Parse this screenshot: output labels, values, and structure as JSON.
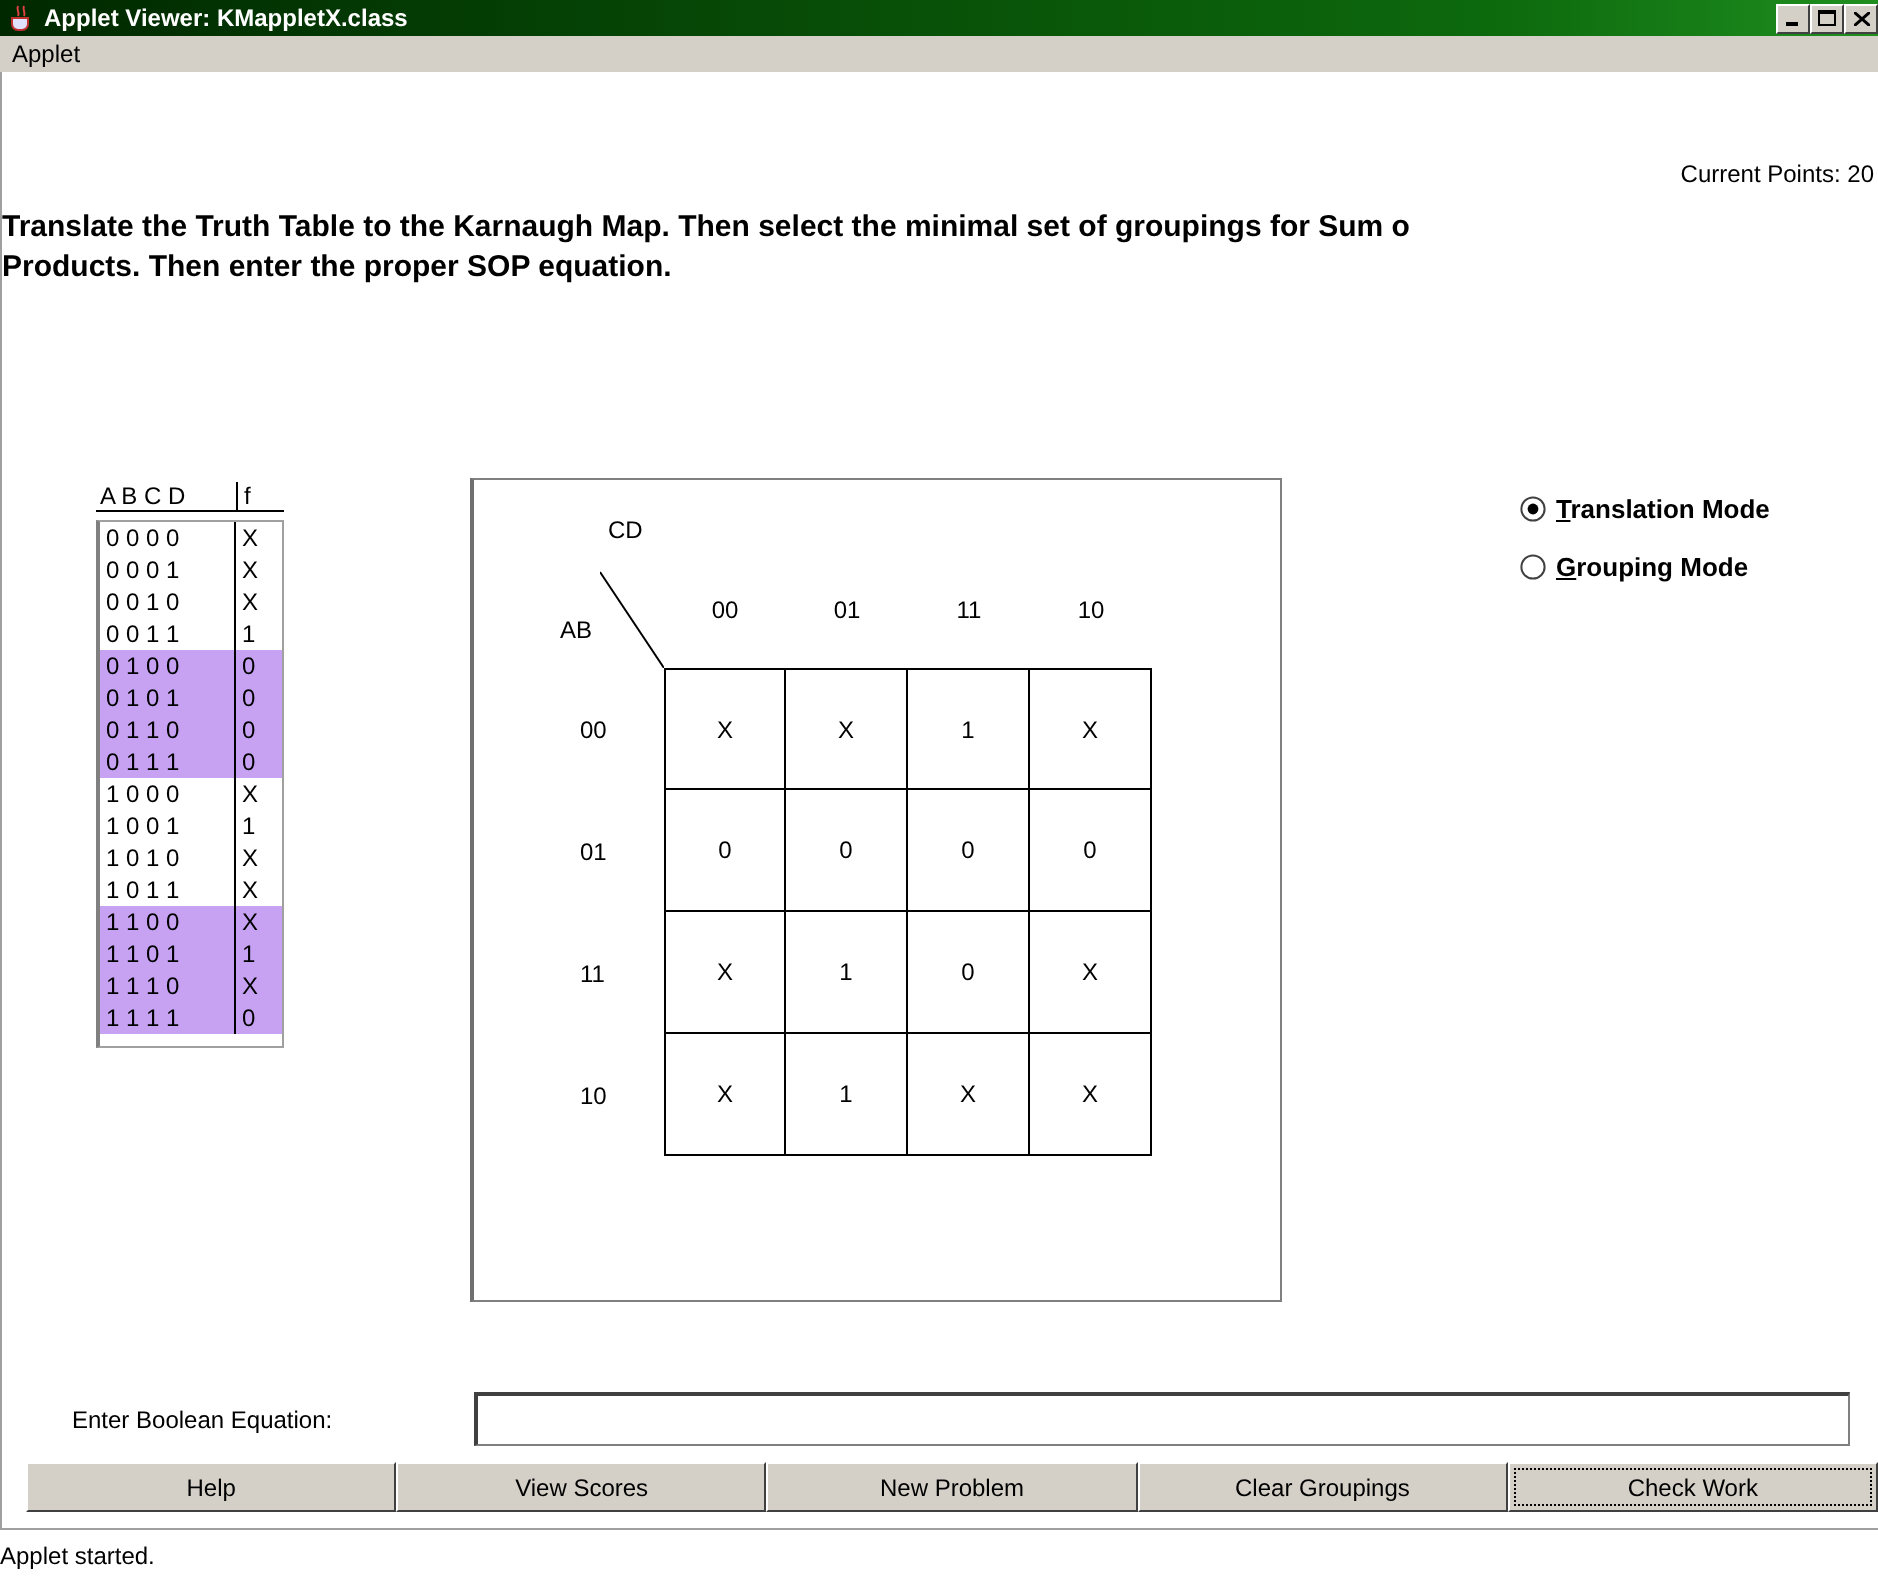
{
  "window": {
    "title": "Applet Viewer: KMappletX.class"
  },
  "menu": [
    "Applet"
  ],
  "points": "Current Points: 20",
  "instructions": [
    "Translate the Truth Table to the Karnaugh Map. Then select the minimal set of groupings for Sum o",
    "Products. Then enter the proper SOP equation."
  ],
  "truth_table": {
    "input_header": "A B C D",
    "output_header": "f",
    "rows": [
      {
        "inputs": "0 0 0 0",
        "f": "X",
        "highlighted": false
      },
      {
        "inputs": "0 0 0 1",
        "f": "X",
        "highlighted": false
      },
      {
        "inputs": "0 0 1 0",
        "f": "X",
        "highlighted": false
      },
      {
        "inputs": "0 0 1 1",
        "f": "1",
        "highlighted": false
      },
      {
        "inputs": "0 1 0 0",
        "f": "0",
        "highlighted": true
      },
      {
        "inputs": "0 1 0 1",
        "f": "0",
        "highlighted": true
      },
      {
        "inputs": "0 1 1 0",
        "f": "0",
        "highlighted": true
      },
      {
        "inputs": "0 1 1 1",
        "f": "0",
        "highlighted": true
      },
      {
        "inputs": "1 0 0 0",
        "f": "X",
        "highlighted": false
      },
      {
        "inputs": "1 0 0 1",
        "f": "1",
        "highlighted": false
      },
      {
        "inputs": "1 0 1 0",
        "f": "X",
        "highlighted": false
      },
      {
        "inputs": "1 0 1 1",
        "f": "X",
        "highlighted": false
      },
      {
        "inputs": "1 1 0 0",
        "f": "X",
        "highlighted": true
      },
      {
        "inputs": "1 1 0 1",
        "f": "1",
        "highlighted": true
      },
      {
        "inputs": "1 1 1 0",
        "f": "X",
        "highlighted": true
      },
      {
        "inputs": "1 1 1 1",
        "f": "0",
        "highlighted": true
      }
    ]
  },
  "kmap": {
    "column_variables": "CD",
    "row_variables": "AB",
    "columns": [
      "00",
      "01",
      "11",
      "10"
    ],
    "rows": [
      {
        "label": "00",
        "cells": [
          "X",
          "X",
          "1",
          "X"
        ]
      },
      {
        "label": "01",
        "cells": [
          "0",
          "0",
          "0",
          "0"
        ]
      },
      {
        "label": "11",
        "cells": [
          "X",
          "1",
          "0",
          "X"
        ]
      },
      {
        "label": "10",
        "cells": [
          "X",
          "1",
          "X",
          "X"
        ]
      }
    ]
  },
  "modes": [
    {
      "label": "Translation Mode",
      "selected": true
    },
    {
      "label": "Grouping Mode",
      "selected": false
    }
  ],
  "equation": {
    "label": "Enter Boolean Equation:"
  },
  "buttons": [
    {
      "label": "Help",
      "focused": false
    },
    {
      "label": "View Scores",
      "focused": false
    },
    {
      "label": "New Problem",
      "focused": false
    },
    {
      "label": "Clear Groupings",
      "focused": false
    },
    {
      "label": "Check Work",
      "focused": true
    }
  ],
  "status_bar": "Applet started."
}
